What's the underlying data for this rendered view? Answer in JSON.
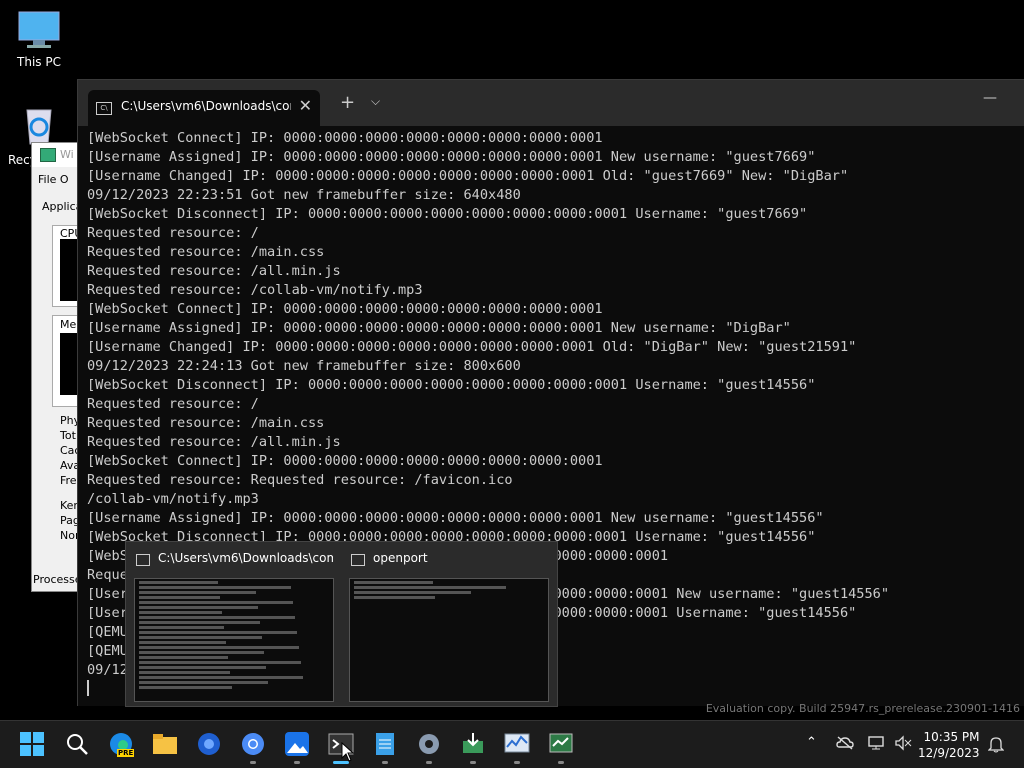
{
  "desktop": {
    "icons": [
      {
        "label": "This PC"
      },
      {
        "label": "Recy"
      }
    ]
  },
  "taskmgr": {
    "title": "Wi",
    "menu": "File O",
    "tab": "Applica",
    "cpu": "CPU",
    "mem": "Men",
    "rows": [
      "Phy",
      "Tot",
      "Cac",
      "Ava",
      "Fre"
    ],
    "rows2": [
      "Ker",
      "Pag",
      "Nor"
    ],
    "footer": "Processe"
  },
  "terminal": {
    "tab_title": "C:\\Users\\vm6\\Downloads\\con",
    "lines": [
      "[WebSocket Connect] IP: 0000:0000:0000:0000:0000:0000:0000:0001",
      "[Username Assigned] IP: 0000:0000:0000:0000:0000:0000:0000:0001 New username: \"guest7669\"",
      "[Username Changed] IP: 0000:0000:0000:0000:0000:0000:0000:0001 Old: \"guest7669\" New: \"DigBar\"",
      "09/12/2023 22:23:51 Got new framebuffer size: 640x480",
      "[WebSocket Disconnect] IP: 0000:0000:0000:0000:0000:0000:0000:0001 Username: \"guest7669\"",
      "Requested resource: /",
      "Requested resource: /main.css",
      "Requested resource: /all.min.js",
      "Requested resource: /collab-vm/notify.mp3",
      "[WebSocket Connect] IP: 0000:0000:0000:0000:0000:0000:0000:0001",
      "[Username Assigned] IP: 0000:0000:0000:0000:0000:0000:0000:0001 New username: \"DigBar\"",
      "[Username Changed] IP: 0000:0000:0000:0000:0000:0000:0000:0001 Old: \"DigBar\" New: \"guest21591\"",
      "09/12/2023 22:24:13 Got new framebuffer size: 800x600",
      "[WebSocket Disconnect] IP: 0000:0000:0000:0000:0000:0000:0000:0001 Username: \"guest14556\"",
      "Requested resource: /",
      "Requested resource: /main.css",
      "Requested resource: /all.min.js",
      "[WebSocket Connect] IP: 0000:0000:0000:0000:0000:0000:0000:0001",
      "Requested resource: Requested resource: /favicon.ico",
      "/collab-vm/notify.mp3",
      "[Username Assigned] IP: 0000:0000:0000:0000:0000:0000:0000:0001 New username: \"guest14556\"",
      "[WebSocket Disconnect] IP: 0000:0000:0000:0000:0000:0000:0000:0001 Username: \"guest14556\"",
      "[WebS                                              :0000:0000:0000:0001",
      "Reque",
      "[User                                              :0000:0000:0000:0001 New username: \"guest14556\"",
      "[User                                              :0000:0000:0000:0001 Username: \"guest14556\"",
      "[QEMU",
      "[QEMU",
      "09/12                                                 0"
    ]
  },
  "thumbnails": [
    {
      "title": "C:\\Users\\vm6\\Downloads\\com..."
    },
    {
      "title": "openport"
    }
  ],
  "watermark": "Evaluation copy. Build 25947.rs_prerelease.230901-1416",
  "taskbar": {
    "time": "10:35 PM",
    "date": "12/9/2023",
    "edge_badge": "PRE"
  }
}
